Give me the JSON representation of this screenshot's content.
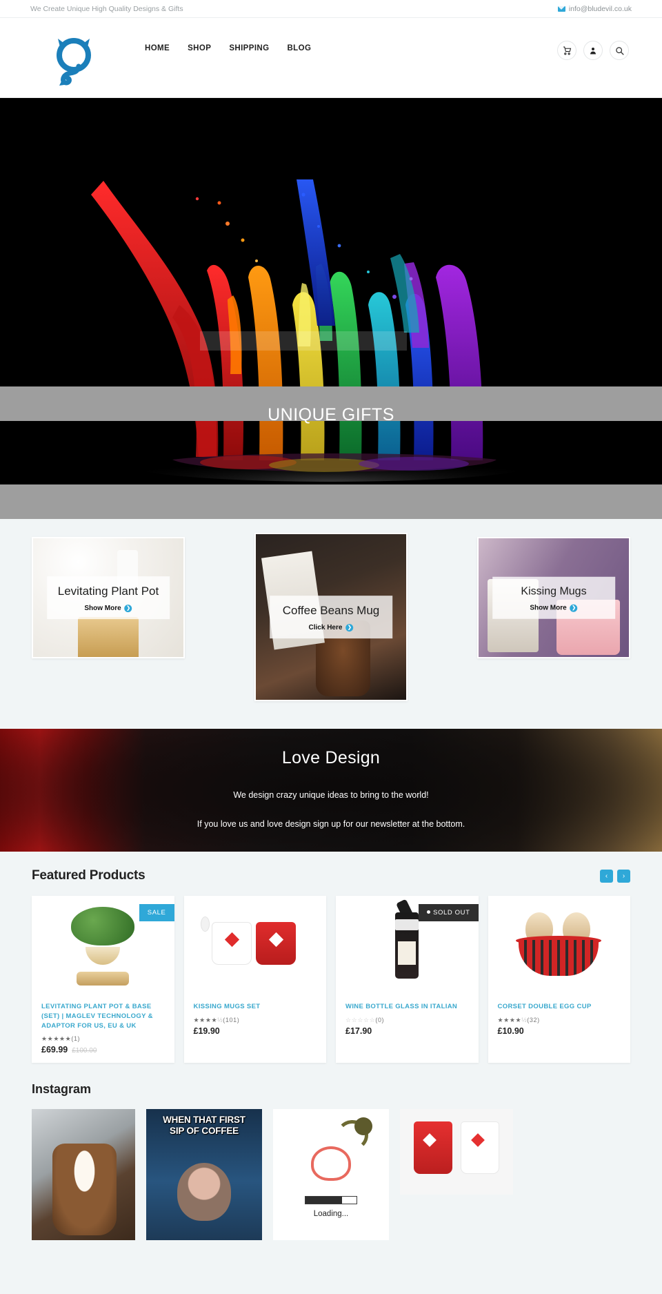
{
  "topbar": {
    "tagline": "We Create Unique High Quality Designs & Gifts",
    "email": "info@bludevil.co.uk",
    "email_icon": "envelope-icon"
  },
  "header": {
    "logo_alt": "bludevil-logo",
    "nav": [
      {
        "label": "HOME"
      },
      {
        "label": "SHOP"
      },
      {
        "label": "SHIPPING"
      },
      {
        "label": "BLOG"
      }
    ],
    "actions": [
      {
        "icon": "cart-icon"
      },
      {
        "icon": "user-icon"
      },
      {
        "icon": "search-icon"
      }
    ]
  },
  "hero": {
    "image_alt": "colorful-paint-splash",
    "band_title": "UNIQUE GIFTS"
  },
  "gifts": [
    {
      "title": "Levitating Plant Pot",
      "cta": "Show More",
      "cta_icon": "arrow-right-circle-icon",
      "image_alt": "levitating-plant-pot-photo"
    },
    {
      "title": "Coffee Beans Mug",
      "cta": "Click Here",
      "cta_icon": "arrow-right-circle-icon",
      "image_alt": "coffee-beans-mug-photo"
    },
    {
      "title": "Kissing Mugs",
      "cta": "Show More",
      "cta_icon": "arrow-right-circle-icon",
      "image_alt": "kissing-mugs-photo"
    }
  ],
  "love": {
    "title": "Love Design",
    "line1": "We design crazy unique ideas to bring to the world!",
    "line2": "If you love us and love design sign up for our newsletter at the bottom.",
    "background_alt": "red-rose-and-gold-texture"
  },
  "featured": {
    "heading": "Featured Products",
    "prev_label": "‹",
    "next_label": "›",
    "products": [
      {
        "badge": "SALE",
        "badge_type": "sale",
        "title": "LEVITATING PLANT POT & BASE (SET) | MAGLEV TECHNOLOGY & ADAPTOR FOR US, EU & UK",
        "stars": "★★★★★",
        "stars_empty": "",
        "review_count": "(1)",
        "price": "£69.99",
        "old_price": "£100.00",
        "image_alt": "bonsai-levitating-pot"
      },
      {
        "badge": "",
        "badge_type": "",
        "title": "KISSING MUGS SET",
        "stars": "★★★★",
        "stars_empty": "½",
        "review_count": "(101)",
        "price": "£19.90",
        "old_price": "",
        "image_alt": "kissing-mugs-set"
      },
      {
        "badge": "SOLD OUT",
        "badge_type": "sold",
        "title": "WINE BOTTLE GLASS IN ITALIAN",
        "stars": "",
        "stars_empty": "☆☆☆☆☆",
        "review_count": "(0)",
        "price": "£17.90",
        "old_price": "",
        "image_alt": "wine-bottle-glass"
      },
      {
        "badge": "",
        "badge_type": "",
        "title": "CORSET DOUBLE EGG CUP",
        "stars": "★★★★",
        "stars_empty": "½",
        "review_count": "(32)",
        "price": "£10.90",
        "old_price": "",
        "image_alt": "corset-double-egg-cup"
      }
    ]
  },
  "instagram": {
    "heading": "Instagram",
    "posts": [
      {
        "alt": "coffee-beans-mug-with-cream",
        "caption": ""
      },
      {
        "alt": "monkey-meme",
        "caption_line1": "WHEN THAT FIRST",
        "caption_line2": "SIP OF COFFEE"
      },
      {
        "alt": "brain-charging-loading",
        "caption": "Loading..."
      },
      {
        "alt": "red-and-white-kissing-mugs",
        "caption": ""
      }
    ]
  },
  "colors": {
    "accent": "#2fa8d8",
    "link": "#39a8cd",
    "page_bg": "#f1f5f6",
    "band_gray": "#9e9e9e"
  }
}
